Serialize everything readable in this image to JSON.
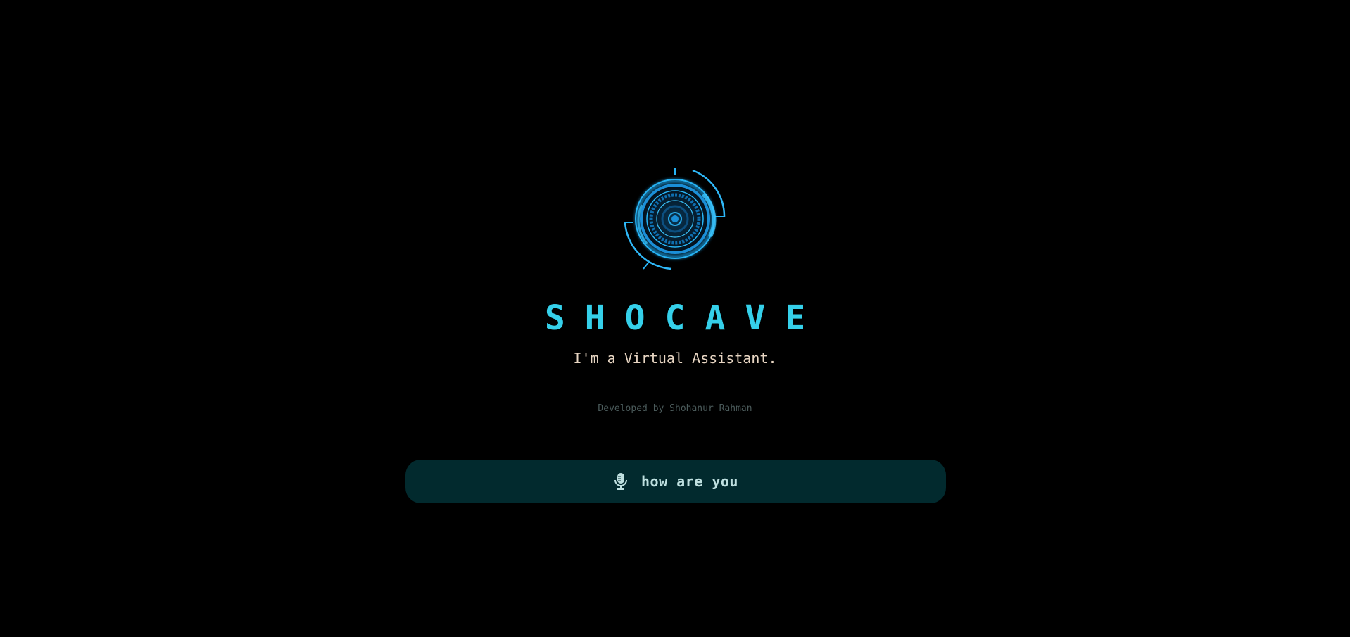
{
  "app": {
    "title": "SHOCAVE",
    "subtitle": "I'm a Virtual Assistant.",
    "credit": "Developed by Shohanur Rahman"
  },
  "logo": {
    "icon": "hud-eye-logo",
    "color": "#1fa3e8"
  },
  "voice_input": {
    "icon": "microphone-icon",
    "text": "how are you",
    "background": "#022a2e"
  },
  "colors": {
    "background": "#000000",
    "accent": "#35d0ea",
    "subtitle": "#e8d6c3",
    "credit": "#4b5b5b"
  }
}
